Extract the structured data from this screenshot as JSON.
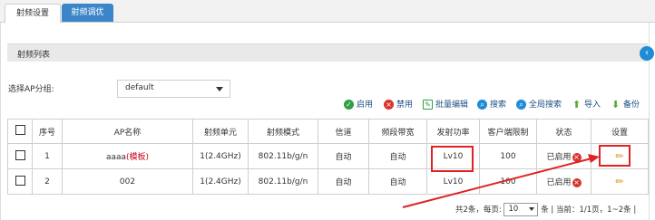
{
  "tabs": [
    {
      "label": "射频设置"
    },
    {
      "label": "射频调优"
    }
  ],
  "section_title": "射频列表",
  "ap_group": {
    "label": "选择AP分组:",
    "selected": "default"
  },
  "toolbar": [
    {
      "label": "启用",
      "icon": "check-circle-icon",
      "color": "#2f9e44"
    },
    {
      "label": "禁用",
      "icon": "x-circle-icon",
      "color": "#d9332c"
    },
    {
      "label": "批量编辑",
      "icon": "edit-box-icon",
      "color": "#2f9e44"
    },
    {
      "label": "搜索",
      "icon": "search-icon",
      "color": "#1f8dd6"
    },
    {
      "label": "全局搜索",
      "icon": "global-search-icon",
      "color": "#1f8dd6"
    },
    {
      "label": "导入",
      "icon": "import-arrow-icon",
      "color": "#5aa832"
    },
    {
      "label": "备份",
      "icon": "backup-arrow-icon",
      "color": "#5aa832"
    }
  ],
  "table": {
    "headers": [
      "",
      "序号",
      "AP名称",
      "射频单元",
      "射频模式",
      "信道",
      "频段带宽",
      "发射功率",
      "客户端限制",
      "状态",
      "设置"
    ],
    "rows": [
      {
        "index": "1",
        "name": "aaaa",
        "template": "(模板)",
        "unit": "1(2.4GHz)",
        "mode": "802.11b/g/n",
        "channel": "自动",
        "bandwidth": "自动",
        "power": "Lv10",
        "client_limit": "100",
        "status": "已启用"
      },
      {
        "index": "2",
        "name": "002",
        "template": "",
        "unit": "1(2.4GHz)",
        "mode": "802.11b/g/n",
        "channel": "自动",
        "bandwidth": "自动",
        "power": "Lv10",
        "client_limit": "100",
        "status": "已启用"
      }
    ]
  },
  "footer": {
    "total": "共2条，每页:",
    "per_page": "10",
    "unit": "条",
    "sep": "|",
    "current": "当前：1/1页，1~2条",
    "sep2": "|"
  },
  "colors": {
    "accent": "#3a86c8",
    "highlight": "#e02222"
  }
}
